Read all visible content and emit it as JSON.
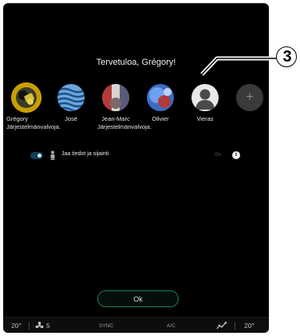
{
  "header": {
    "welcome": "Tervetuloa, Grégory!"
  },
  "users": [
    {
      "name": "Grégory",
      "role": "Järjestelmänvalvoja."
    },
    {
      "name": "José",
      "role": ""
    },
    {
      "name": "Jean-Marc",
      "role": "Järjestelmänvalvoja."
    },
    {
      "name": "Olivier",
      "role": ""
    },
    {
      "name": "Vieras",
      "role": ""
    }
  ],
  "add_user": {
    "symbol": "+"
  },
  "share": {
    "label": "Jaa tiedot ja sijainti",
    "state_label": "On",
    "info_symbol": "i"
  },
  "ok_button": {
    "label": "Ok"
  },
  "bottom_bar": {
    "left_temp": "20°",
    "fan_level": "5",
    "sync_label": "SYNC",
    "ac_label": "A/C",
    "right_temp": "20°"
  },
  "callout": {
    "number": "3"
  }
}
